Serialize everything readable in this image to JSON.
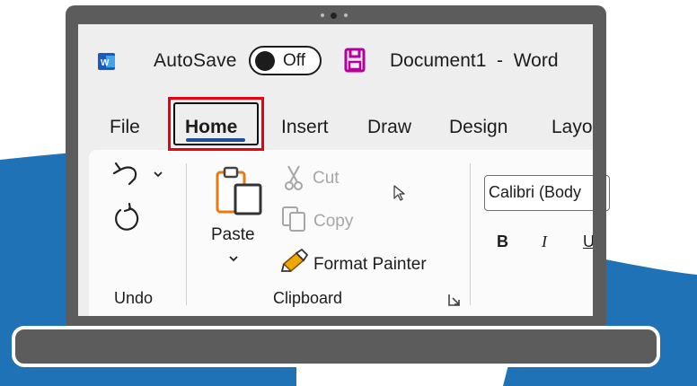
{
  "title_bar": {
    "autosave_label": "AutoSave",
    "autosave_toggle": "Off",
    "document_title": "Document1  -  Word"
  },
  "tabs": [
    {
      "label": "File"
    },
    {
      "label": "Home",
      "selected": true,
      "highlighted": true
    },
    {
      "label": "Insert"
    },
    {
      "label": "Draw"
    },
    {
      "label": "Design"
    },
    {
      "label": "Layo"
    }
  ],
  "ribbon": {
    "undo_group": {
      "label": "Undo",
      "icons": [
        "undo-icon",
        "redo-icon"
      ]
    },
    "clipboard_group": {
      "label": "Clipboard",
      "paste_label": "Paste",
      "cut_label": "Cut",
      "copy_label": "Copy",
      "format_painter_label": "Format Painter"
    },
    "font_group": {
      "font_name": "Calibri (Body",
      "bold": "B",
      "italic": "I",
      "underline": "U"
    }
  },
  "colors": {
    "highlight": "#e60012",
    "accent_underline": "#1f4e96",
    "background_blue": "#1f72b6",
    "word_blue": "#185abd",
    "save_purple": "#b4009e",
    "laptop_body": "#5c5c5c"
  }
}
